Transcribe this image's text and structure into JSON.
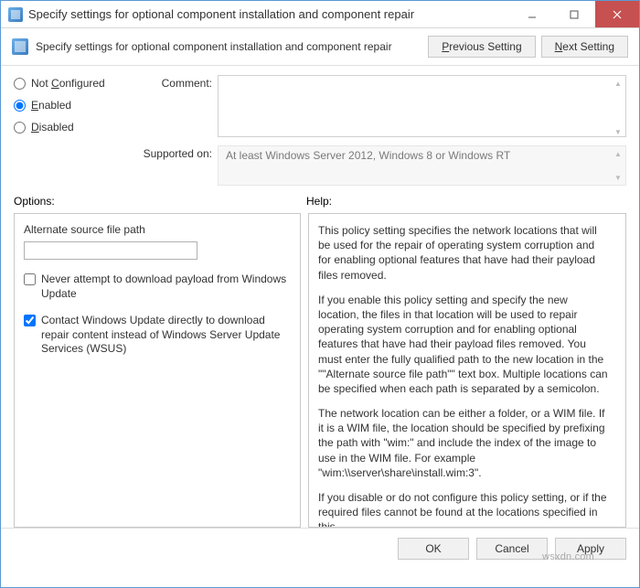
{
  "window": {
    "title": "Specify settings for optional component installation and component repair"
  },
  "toolbar": {
    "subtitle": "Specify settings for optional component installation and component repair",
    "prev_label": "Previous Setting",
    "next_label": "Next Setting",
    "prev_key": "P",
    "next_key": "N"
  },
  "state": {
    "not_configured_label": "Not Configured",
    "not_configured_key": "C",
    "enabled_label": "Enabled",
    "enabled_key": "E",
    "disabled_label": "Disabled",
    "disabled_key": "D",
    "selected": "enabled"
  },
  "fields": {
    "comment_label": "Comment:",
    "comment_value": "",
    "supported_label": "Supported on:",
    "supported_value": "At least Windows Server 2012, Windows 8 or Windows RT"
  },
  "panels": {
    "options_label": "Options:",
    "help_label": "Help:"
  },
  "options": {
    "alt_path_label": "Alternate source file path",
    "alt_path_value": "",
    "never_wu_label": "Never attempt to download payload from Windows Update",
    "never_wu_checked": false,
    "wsus_label": "Contact Windows Update directly to download repair content instead of Windows Server Update Services (WSUS)",
    "wsus_checked": true
  },
  "help": {
    "p1": "This policy setting specifies the network locations that will be used for the repair of operating system corruption and for enabling optional features that have had their payload files removed.",
    "p2": "If you enable this policy setting and specify the new location, the files in that location will be used to repair operating system corruption and for enabling optional features that have had their payload files removed. You must enter the fully qualified path to the new location in the \"\"Alternate source file path\"\" text box. Multiple locations can be specified when each path is separated by a semicolon.",
    "p3": "The network location can be either a folder, or a WIM file. If it is a WIM file, the location should be specified by prefixing the path with \"wim:\" and include the index of the image to use in the WIM file. For example \"wim:\\\\server\\share\\install.wim:3\".",
    "p4": "If you disable or do not configure this policy setting, or if the required files cannot be found at the locations specified in this"
  },
  "footer": {
    "ok": "OK",
    "cancel": "Cancel",
    "apply": "Apply"
  },
  "watermark": "wsxdn.com"
}
